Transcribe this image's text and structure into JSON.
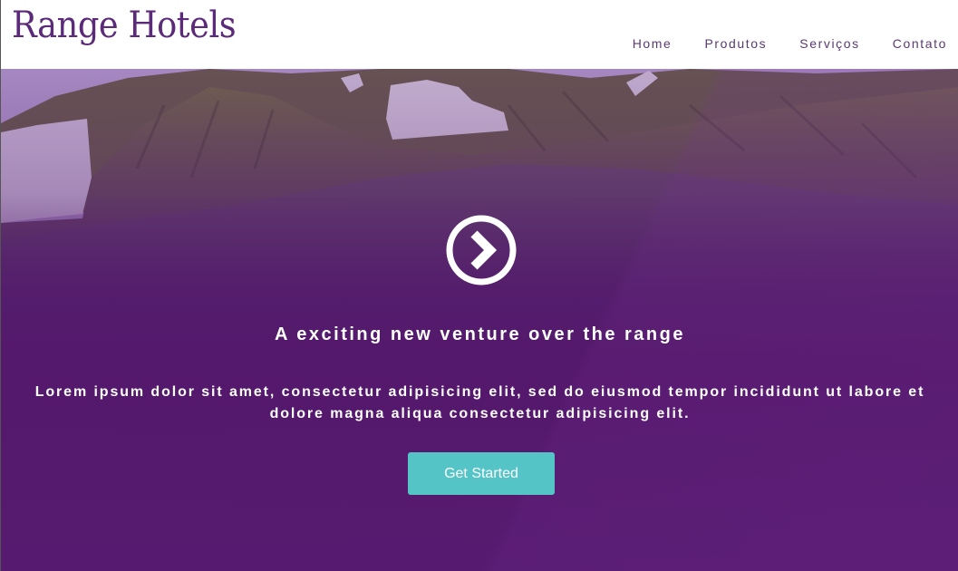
{
  "brand": {
    "name": "Range Hotels",
    "color": "#5b2a79"
  },
  "nav": {
    "items": [
      {
        "label": "Home"
      },
      {
        "label": "Produtos"
      },
      {
        "label": "Serviços"
      },
      {
        "label": "Contato"
      }
    ]
  },
  "hero": {
    "icon": "chevron-right-circle-icon",
    "headline": "A exciting new venture over the range",
    "lead": "Lorem ipsum dolor sit amet, consectetur adipisicing elit, sed do eiusmod tempor incididunt ut labore et dolore magna aliqua consectetur adipisicing elit.",
    "cta_label": "Get Started",
    "accent_color": "#55c4c6",
    "overlay_color": "#54186c"
  }
}
